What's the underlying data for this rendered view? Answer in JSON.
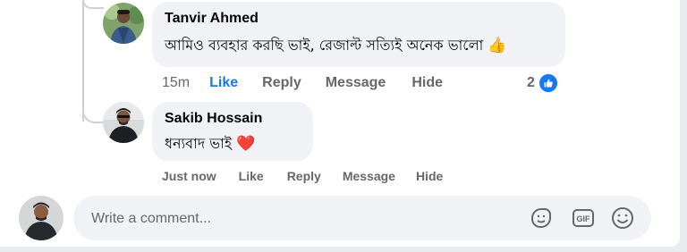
{
  "comments": [
    {
      "author": "Tanvir Ahmed",
      "text": "আমিও ব্যবহার করছি ভাই, রেজাল্ট সত্যিই অনেক ভালো",
      "emoji": "👍",
      "time": "15m",
      "like_label": "Like",
      "reply_label": "Reply",
      "message_label": "Message",
      "hide_label": "Hide",
      "like_count": "2",
      "liked": true
    },
    {
      "author": "Sakib Hossain",
      "text": "ধন্যবাদ ভাই",
      "emoji": "❤️",
      "time": "Just now",
      "like_label": "Like",
      "reply_label": "Reply",
      "message_label": "Message",
      "hide_label": "Hide"
    }
  ],
  "composer": {
    "placeholder": "Write a comment...",
    "icons": [
      "sticker-icon",
      "gif-icon",
      "emoji-icon"
    ]
  },
  "colors": {
    "accent": "#1877f2",
    "bubble": "#f0f2f5",
    "muted_text": "#65676b",
    "heart": "#e41e3f"
  }
}
